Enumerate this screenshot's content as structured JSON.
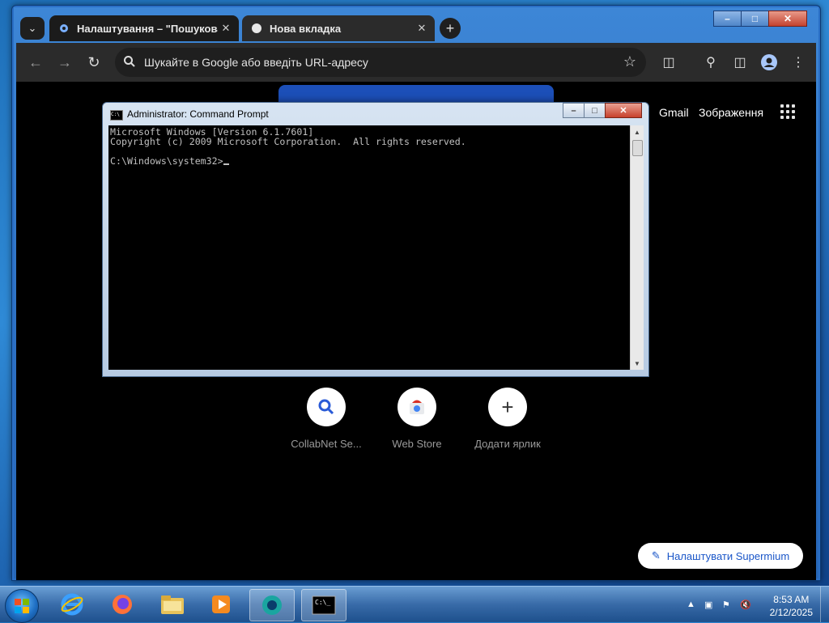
{
  "browser": {
    "tabs": [
      {
        "label": "Налаштування – \"Пошукова с",
        "icon": "gear-icon"
      },
      {
        "label": "Нова вкладка",
        "icon": "globe-icon"
      }
    ],
    "omnibox_placeholder": "Шукайте в Google або введіть URL-адресу",
    "top_links": {
      "gmail": "Gmail",
      "images": "Зображення"
    },
    "shortcuts": [
      {
        "label": "CollabNet Se...",
        "icon": "search-icon"
      },
      {
        "label": "Web Store",
        "icon": "web-store-icon"
      },
      {
        "label": "Додати ярлик",
        "icon": "plus-icon"
      }
    ],
    "customize_label": "Налаштувати Supermium",
    "accent": "#1a56c8"
  },
  "cmd": {
    "title": "Administrator: Command Prompt",
    "lines": [
      "Microsoft Windows [Version 6.1.7601]",
      "Copyright (c) 2009 Microsoft Corporation.  All rights reserved.",
      "",
      "C:\\Windows\\system32>"
    ]
  },
  "taskbar": {
    "apps": [
      "internet-explorer-icon",
      "firefox-icon",
      "file-explorer-icon",
      "media-player-icon",
      "browser-app-icon",
      "cmd-icon"
    ],
    "time": "8:53 AM",
    "date": "2/12/2025"
  }
}
